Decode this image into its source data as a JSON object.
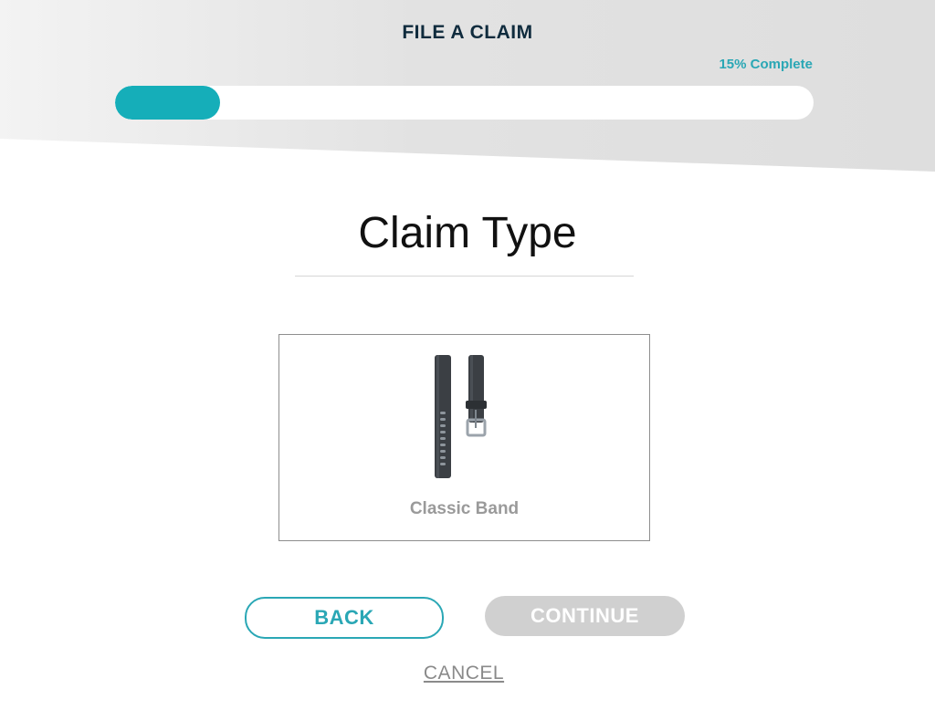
{
  "header": {
    "title": "FILE A CLAIM",
    "progress_label": "15% Complete",
    "progress_fraction": 0.15,
    "accent_color": "#15aeb9"
  },
  "main": {
    "title": "Claim Type",
    "options": [
      {
        "label": "Classic Band",
        "icon": "classic-band-image"
      }
    ]
  },
  "actions": {
    "back_label": "BACK",
    "continue_label": "CONTINUE",
    "cancel_label": "CANCEL"
  }
}
